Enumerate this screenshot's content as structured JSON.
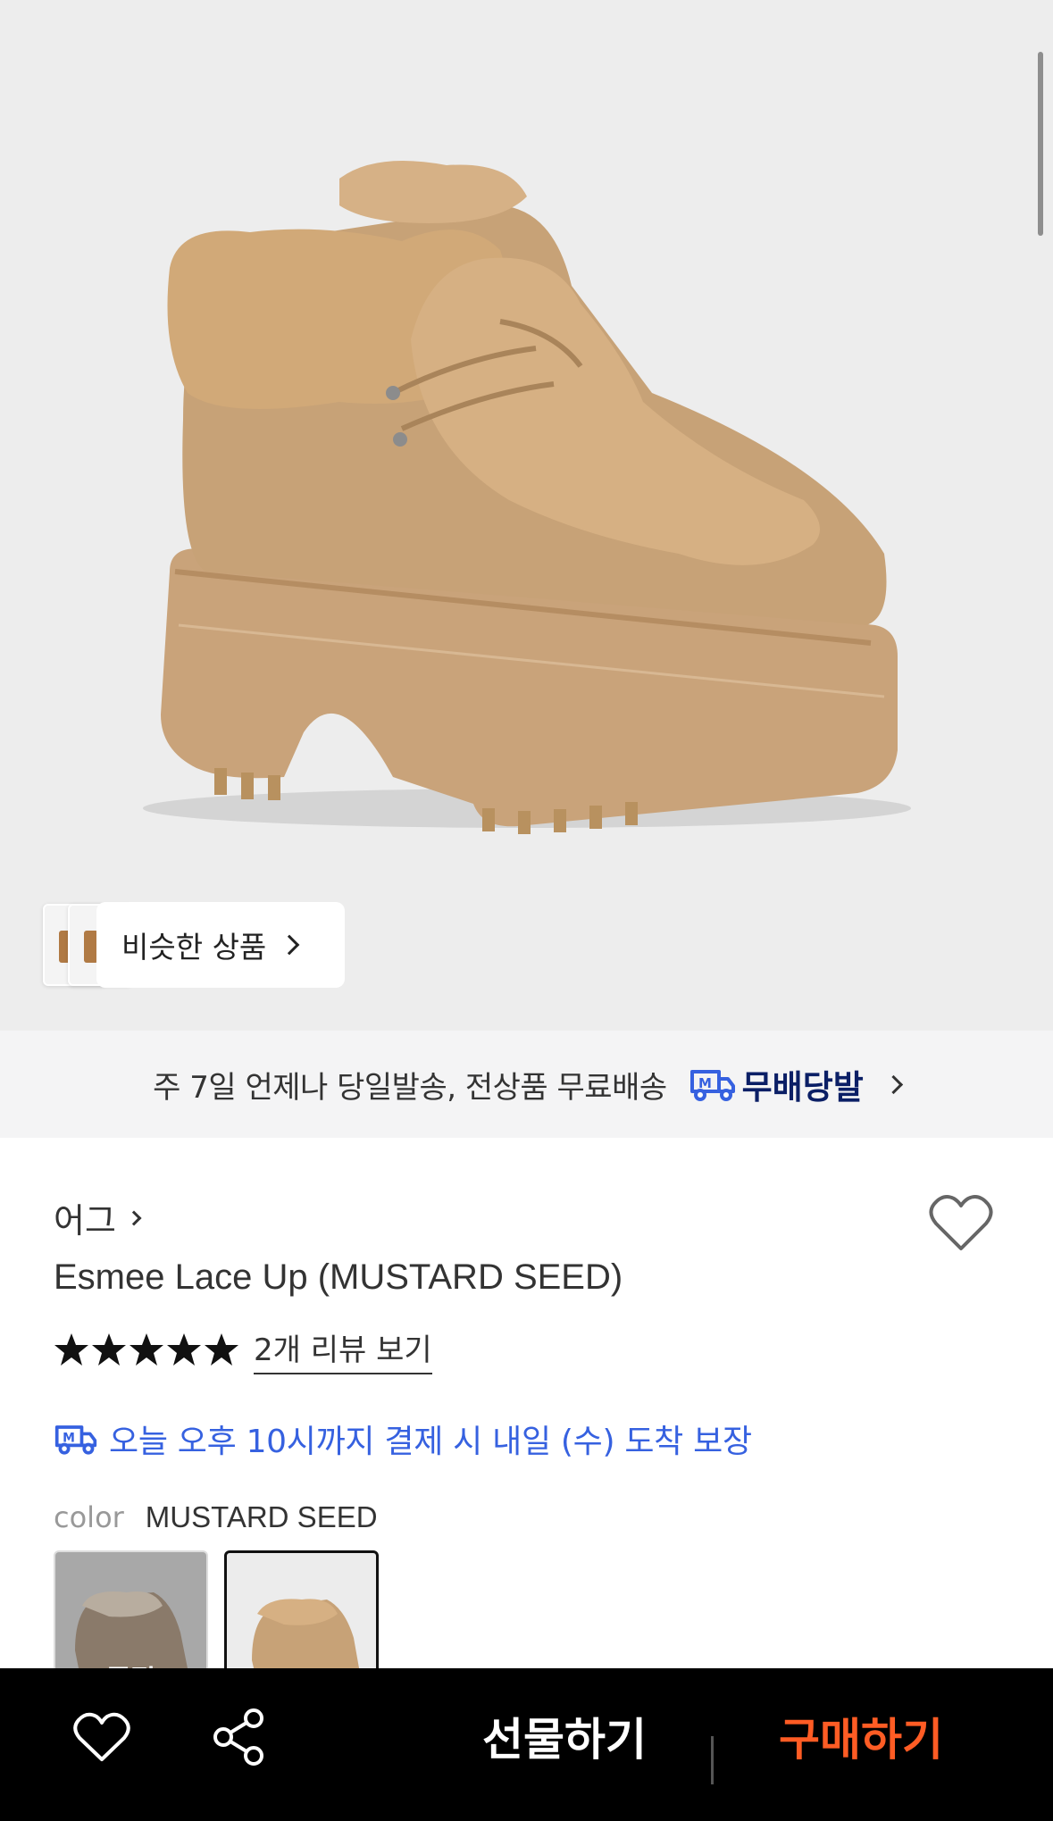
{
  "gallery": {
    "similar_label": "비슷한 상품",
    "product_image_alt": "Esmee Lace Up boot"
  },
  "shipping_banner": {
    "text": "주 7일 언제나 당일발송, 전상품 무료배송",
    "brand": "무배당발",
    "icon": "delivery-truck-icon",
    "accent_color": "#3661e0"
  },
  "product": {
    "brand": "어그",
    "title": "Esmee Lace Up (MUSTARD SEED)",
    "rating": 5,
    "review_link": "2개 리뷰 보기",
    "delivery_text": "오늘 오후 10시까지 결제 시 내일 (수) 도착 보장",
    "color_label": "color",
    "color_value": "MUSTARD SEED",
    "options": [
      {
        "status": "soldout",
        "label": "품절"
      },
      {
        "status": "selected",
        "label": ""
      }
    ]
  },
  "bottom_bar": {
    "gift_label": "선물하기",
    "buy_label": "구매하기",
    "buy_color": "#ff5c24"
  }
}
